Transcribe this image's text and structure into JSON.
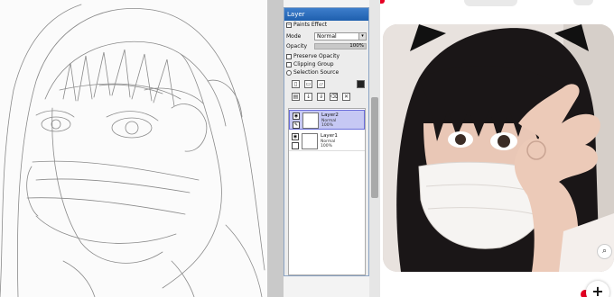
{
  "layer_panel": {
    "title": "Layer",
    "paints_effect": "Paints Effect",
    "mode_label": "Mode",
    "mode_value": "Normal",
    "opacity_label": "Opacity",
    "opacity_value": "100%",
    "preserve_opacity": "Preserve Opacity",
    "clipping_group": "Clipping Group",
    "selection_source": "Selection Source",
    "layers": [
      {
        "name": "Layer2",
        "mode": "Normal",
        "opacity": "100%",
        "selected": true
      },
      {
        "name": "Layer1",
        "mode": "Normal",
        "opacity": "100%",
        "selected": false
      }
    ],
    "icons": [
      "new-layer-icon",
      "new-folder-icon",
      "open-folder-icon",
      "fill-icon",
      "transfer-down-icon",
      "merge-down-icon",
      "clear-icon",
      "delete-icon",
      "mask-icon"
    ]
  },
  "colors": {
    "title_bar": "#1f5fae",
    "selected_layer": "#c6c8f4",
    "pinterest_red": "#e60023"
  },
  "browser": {
    "add_button": "+",
    "visual_search": "⌕"
  }
}
